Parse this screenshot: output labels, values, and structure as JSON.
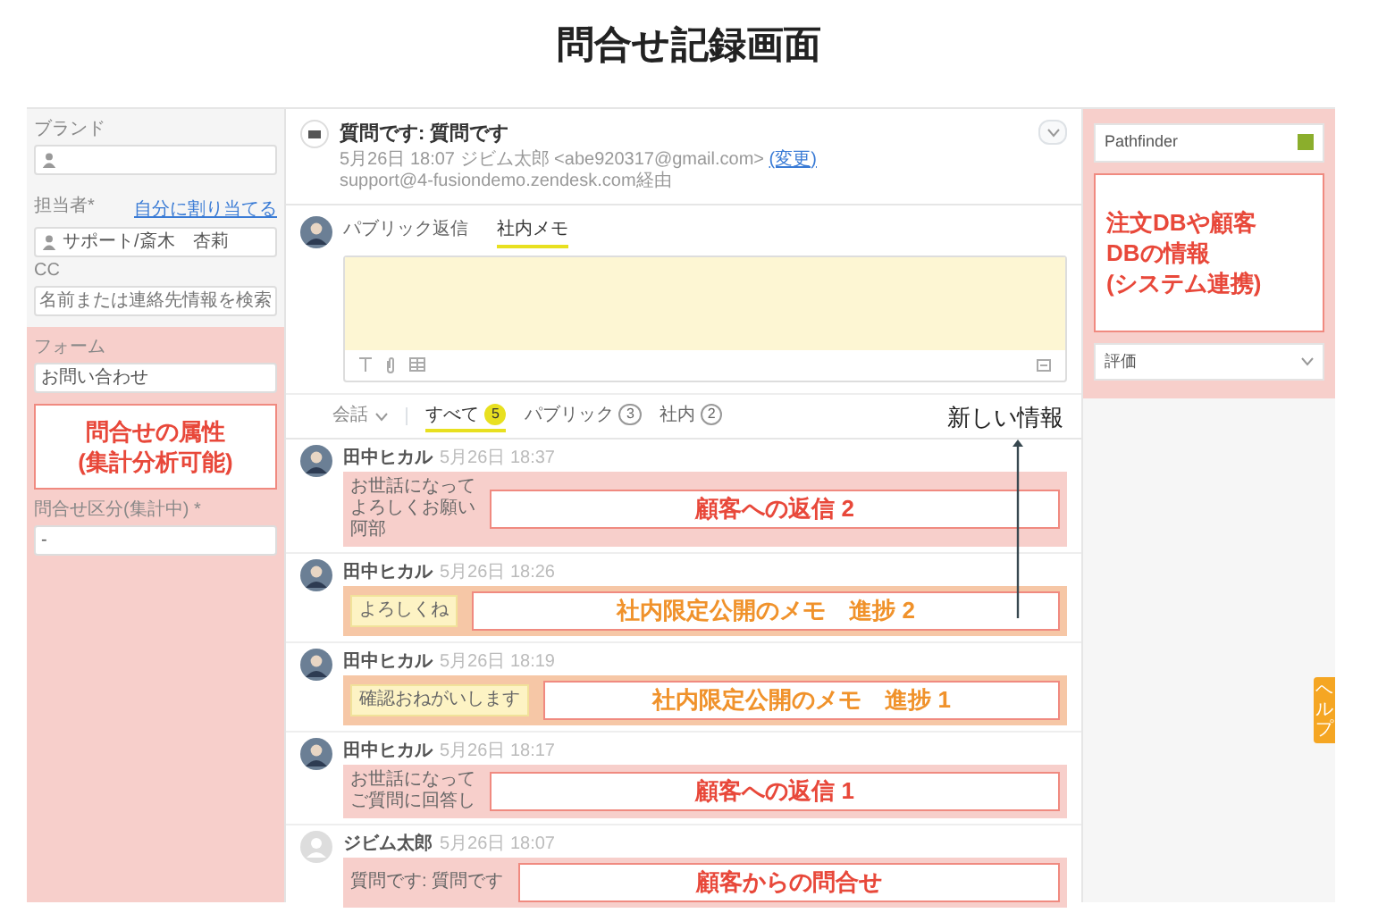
{
  "title": "問合せ記録画面",
  "sidebar": {
    "brand": {
      "label": "ブランド"
    },
    "assignee": {
      "label": "担当者*",
      "link": "自分に割り当てる",
      "value": "サポート/斎木　杏莉"
    },
    "cc": {
      "label": "CC",
      "placeholder": "名前または連絡先情報を検索"
    },
    "form": {
      "label": "フォーム",
      "value": "お問い合わせ"
    },
    "category": {
      "label": "問合せ区分(集計中) *",
      "value": "-"
    },
    "annotation": "問合せの属性\n(集計分析可能)"
  },
  "ticket": {
    "subject": "質問です: 質問です",
    "time": "5月26日 18:07",
    "requester": "ジビム太郎 <abe920317@gmail.com>",
    "change_link": "(変更)",
    "via": "support@4-fusiondemo.zendesk.com経由"
  },
  "composer": {
    "tabs": [
      {
        "label": "パブリック返信",
        "selected": false
      },
      {
        "label": "社内メモ",
        "selected": true
      }
    ]
  },
  "filter": {
    "dropdown": "会話",
    "tabs": [
      {
        "label": "すべて",
        "count": "5",
        "selected": true
      },
      {
        "label": "パブリック",
        "count": "3",
        "selected": false
      },
      {
        "label": "社内",
        "count": "2",
        "selected": false
      }
    ]
  },
  "new_info_label": "新しい情報",
  "messages": [
    {
      "author": "田中ヒカル",
      "time": "5月26日 18:37",
      "kind": "reply",
      "lines": [
        "お世話になって",
        "よろしくお願い",
        "阿部"
      ],
      "annotation": {
        "text": "顧客への返信 2",
        "kind": "customer"
      }
    },
    {
      "author": "田中ヒカル",
      "time": "5月26日 18:26",
      "kind": "note",
      "lines": [
        "よろしくね"
      ],
      "annotation": {
        "text": "社内限定公開のメモ　進捗 2",
        "kind": "internal"
      }
    },
    {
      "author": "田中ヒカル",
      "time": "5月26日 18:19",
      "kind": "note",
      "lines": [
        "確認おねがいします"
      ],
      "annotation": {
        "text": "社内限定公開のメモ　進捗 1",
        "kind": "internal"
      }
    },
    {
      "author": "田中ヒカル",
      "time": "5月26日 18:17",
      "kind": "reply",
      "lines": [
        "お世話になって",
        "ご質問に回答し"
      ],
      "annotation": {
        "text": "顧客への返信 1",
        "kind": "customer"
      }
    },
    {
      "author": "ジビム太郎",
      "time": "5月26日 18:07",
      "kind": "inquiry",
      "lines": [
        "質問です: 質問です"
      ],
      "annotation": {
        "text": "顧客からの問合せ",
        "kind": "customer"
      }
    }
  ],
  "apps_panel": {
    "app_title": "Pathfinder",
    "annotation": "注文DBや顧客\nDBの情報\n(システム連携)",
    "rating_label": "評価"
  },
  "help_tab": "ヘルプ"
}
